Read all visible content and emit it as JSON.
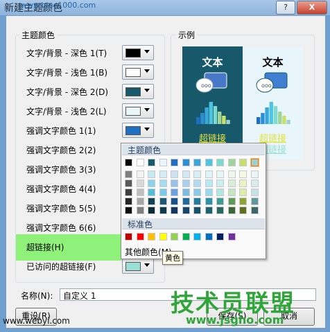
{
  "window": {
    "title": "新建主题颜色",
    "watermark_top": "www.blue1000.com",
    "help": "?",
    "close": "X"
  },
  "theme_group": {
    "title": "主题颜色",
    "rows": [
      {
        "label": "文字/背景 - 深色 1(T)",
        "color": "#000000"
      },
      {
        "label": "文字/背景 - 浅色 1(B)",
        "color": "#ffffff"
      },
      {
        "label": "文字/背景 - 深色 2(D)",
        "color": "#17596b"
      },
      {
        "label": "文字/背景 - 浅色 2(L)",
        "color": "#e8f6fb"
      },
      {
        "label": "强调文字颜色 1(1)",
        "color": "#1e6fbf"
      },
      {
        "label": "强调文字颜色 2(2)",
        "color": null
      },
      {
        "label": "强调文字颜色 3(3)",
        "color": null
      },
      {
        "label": "强调文字颜色 4(4)",
        "color": null
      },
      {
        "label": "强调文字颜色 5(5)",
        "color": null
      },
      {
        "label": "强调文字颜色 6(6)",
        "color": null
      },
      {
        "label": "超链接(H)",
        "color": null
      },
      {
        "label": "已访问的超链接(F)",
        "color": "#9adfd6"
      }
    ]
  },
  "sample_group": {
    "title": "示例",
    "left": {
      "text": "文本",
      "link": "超链接",
      "bg": "#17596b",
      "fg": "#ffffff",
      "link_color": "#e5e23a"
    },
    "right": {
      "text": "文本",
      "link": "超链接",
      "link2": "超链接",
      "bg": "#e8f6fb",
      "fg": "#000000",
      "link_color": "#e5e23a",
      "link2_color": "#9adfd6"
    }
  },
  "color_popup": {
    "theme_header": "主题颜色",
    "standard_header": "标准色",
    "more_colors": "其他颜色(M)...",
    "theme_top_row": [
      "#000000",
      "#ffffff",
      "#17596b",
      "#e8f6fb",
      "#1e6fbf",
      "#2a8fd4",
      "#3aa7d8",
      "#4dc5e0",
      "#7ed9d0",
      "#9fd49b",
      "#c7e06b",
      "#a0cfcf"
    ],
    "theme_columns": [
      [
        "#7f7f7f",
        "#595959",
        "#3f3f3f",
        "#262626",
        "#0d0d0d"
      ],
      [
        "#f2f2f2",
        "#d9d9d9",
        "#bfbfbf",
        "#a6a6a6",
        "#7f7f7f"
      ],
      [
        "#c5e9f3",
        "#8bd3e6",
        "#51bdd9",
        "#114353",
        "#0b2c37"
      ],
      [
        "#d1eef8",
        "#a4ddf0",
        "#76cce9",
        "#1a5a75",
        "#0f3a4d"
      ],
      [
        "#cde0f5",
        "#9bc1eb",
        "#6aa3e1",
        "#175390",
        "#0f3760"
      ],
      [
        "#d3e8f6",
        "#a7d1ed",
        "#7bbbe4",
        "#1f6a9f",
        "#15476a"
      ],
      [
        "#d7eef7",
        "#afdcef",
        "#88cbe8",
        "#227d9f",
        "#17536a"
      ],
      [
        "#dbf3f9",
        "#b7e8f3",
        "#94dced",
        "#2b93a8",
        "#1d6270"
      ],
      [
        "#e5f7f5",
        "#cbefeb",
        "#b1e7e2",
        "#3e9c92",
        "#296861"
      ],
      [
        "#ecf6eb",
        "#d9edd7",
        "#c5e4c3",
        "#5c9b56",
        "#3d6739"
      ],
      [
        "#f4f9e1",
        "#e9f3c3",
        "#ddeca6",
        "#8fa531",
        "#5f6e21"
      ],
      [
        "#ecf5f5",
        "#d9ecec",
        "#c6e2e2",
        "#5c9b9b",
        "#3d6767"
      ]
    ],
    "standard_colors": [
      "#c00000",
      "#ff0000",
      "#ffc000",
      "#ffff00",
      "#92d050",
      "#00b050",
      "#00b0f0",
      "#0070c0",
      "#002060",
      "#7030a0"
    ],
    "selected_index": 11
  },
  "tooltip": "黄色",
  "name_field": {
    "label": "名称(N):",
    "value": "自定义 1"
  },
  "buttons": {
    "reset": "重设(R)",
    "save": "保存(S)",
    "cancel": "取消"
  },
  "watermarks": {
    "left": "www.webyi.com",
    "logo": "技术员联盟",
    "url": "www.jsgho.com"
  }
}
